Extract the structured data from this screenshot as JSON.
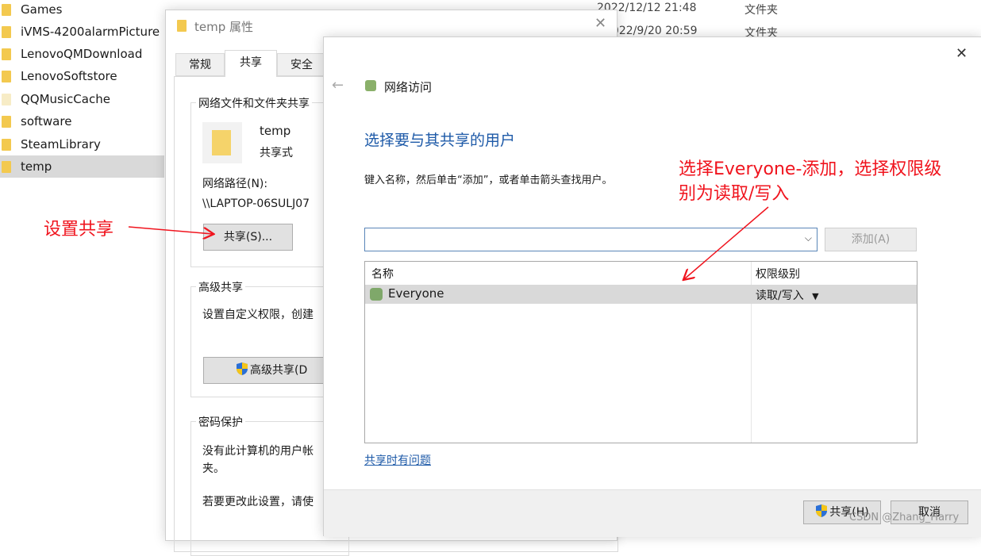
{
  "explorer": {
    "items": [
      "Games",
      "iVMS-4200alarmPicture",
      "LenovoQMDownload",
      "LenovoSoftstore",
      "QQMusicCache",
      "software",
      "SteamLibrary",
      "temp"
    ],
    "selected": "temp",
    "details": [
      {
        "date": "2022/12/12 21:48",
        "type": "文件夹"
      },
      {
        "date": "2022/9/20 20:59",
        "type": "文件夹"
      }
    ]
  },
  "props": {
    "title": "temp 属性",
    "tabs": [
      "常规",
      "共享",
      "安全"
    ],
    "active_tab": "共享",
    "group1": {
      "title": "网络文件和文件夹共享",
      "name": "temp",
      "state": "共享式",
      "path_label": "网络路径(N):",
      "path": "\\\\LAPTOP-06SULJ07",
      "share_button": "共享(S)..."
    },
    "group2": {
      "title": "高级共享",
      "text": "设置自定义权限，创建",
      "button": "高级共享(D"
    },
    "group3": {
      "title": "密码保护",
      "text1": "没有此计算机的用户帐",
      "text1b": "夹。",
      "text2": "若要更改此设置，请使"
    }
  },
  "share": {
    "title": "网络访问",
    "heading": "选择要与其共享的用户",
    "instruction": "键入名称，然后单击“添加”，或者单击箭头查找用户。",
    "input_value": "",
    "add_button": "添加(A)",
    "columns": [
      "名称",
      "权限级别"
    ],
    "rows": [
      {
        "name": "Everyone",
        "permission": "读取/写入"
      }
    ],
    "help_link": "共享时有问题",
    "share_button": "共享(H)",
    "cancel_button": "取消"
  },
  "annotations": {
    "left": "设置共享",
    "right_line1": "选择Everyone-添加，选择权限级",
    "right_line2": "别为读取/写入"
  },
  "watermark": "CSDN @Zhang_Harry",
  "colors": {
    "accent": "#1e5aa8",
    "annotation": "#f0141e",
    "selection": "#d9d9d9"
  }
}
